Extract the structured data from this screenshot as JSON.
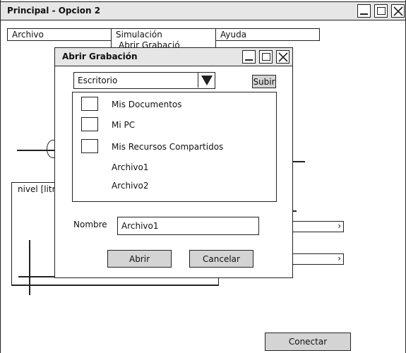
{
  "main_window": {
    "title": "Principal - Opcion 2"
  },
  "menu": {
    "archivo": "Archivo",
    "simulacion": "Simulación",
    "simulacion_sub_partial": "Abrir Grabació",
    "ayuda": "Ayuda"
  },
  "background": {
    "nivel_label": "nivel [litr"
  },
  "dialog": {
    "title": "Abrir Grabación",
    "location": "Escritorio",
    "up_button": "Subir",
    "places": [
      "Mis Documentos",
      "Mi PC",
      "Mis Recursos Compartidos"
    ],
    "files": [
      "Archivo1",
      "Archivo2"
    ],
    "name_label": "Nombre",
    "name_value": "Archivo1",
    "open_button": "Abrir",
    "cancel_button": "Cancelar"
  },
  "footer": {
    "connect_button": "Conectar"
  }
}
